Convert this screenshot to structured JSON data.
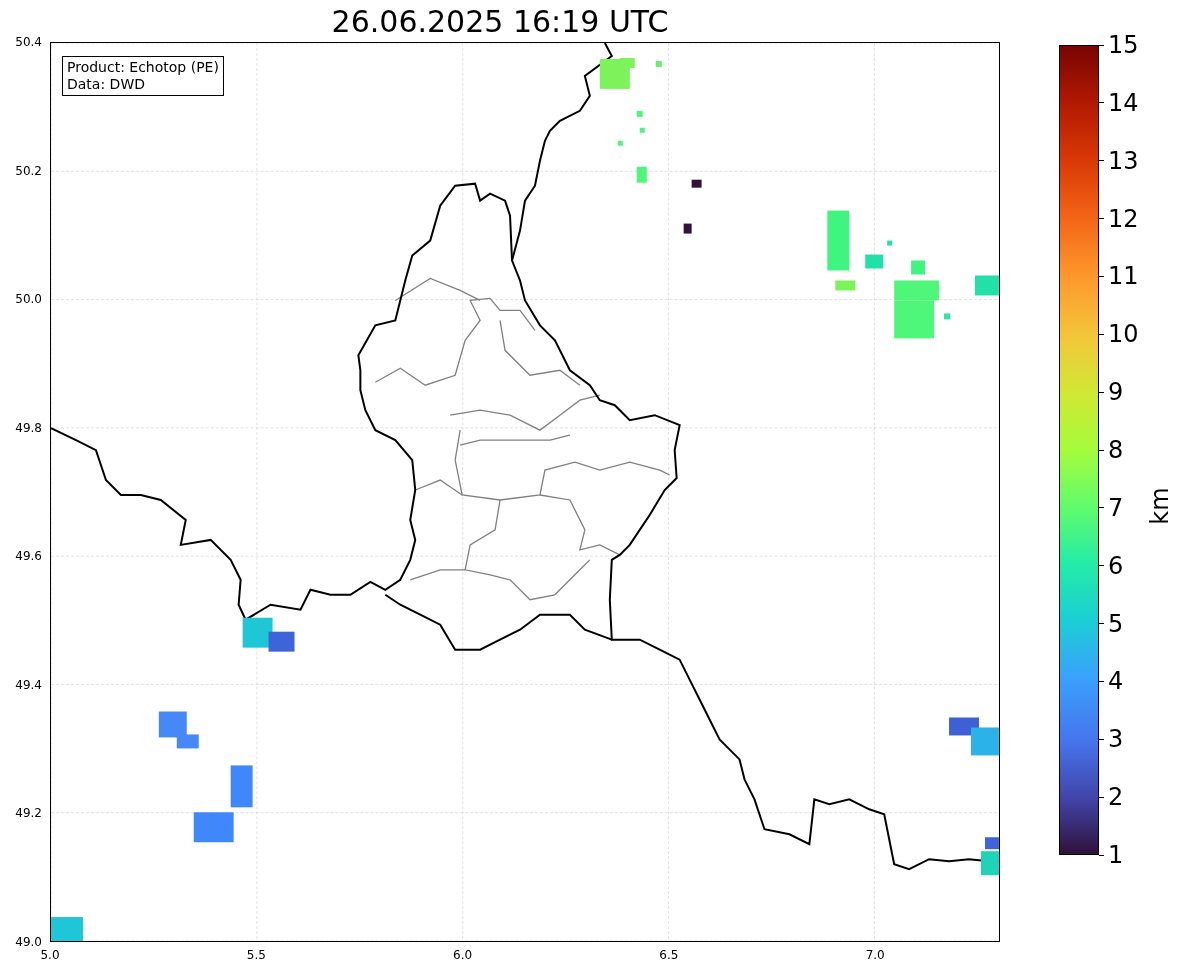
{
  "title": "26.06.2025 16:19 UTC",
  "info_box": [
    "Product: Echotop (PE)",
    "Data: DWD"
  ],
  "y_ticks": [
    "50.4",
    "50.2",
    "50.0",
    "49.8",
    "49.6",
    "49.4",
    "49.2",
    "49.0"
  ],
  "x_ticks": [
    "5.0",
    "5.5",
    "6.0",
    "6.5",
    "7.0"
  ],
  "colorbar": {
    "label": "km",
    "ticks": [
      "15",
      "14",
      "13",
      "12",
      "11",
      "10",
      "9",
      "8",
      "7",
      "6",
      "5",
      "4",
      "3",
      "2",
      "1"
    ]
  }
}
